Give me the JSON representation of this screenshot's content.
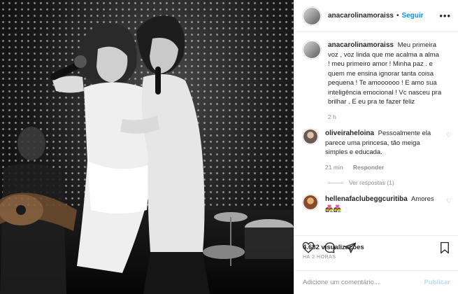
{
  "post": {
    "author": "anacarolinamoraiss",
    "follow_label": "Seguir",
    "separator": "•",
    "more_icon": "more-dots-icon",
    "caption": "Meu primeira voz , voz linda que me acalma a alma ! meu primeiro amor ! Minha paz . e quem me ensina ignorar tanta coisa pequena ! Te amoooooo ! E amo sua inteligência emocional ! Vc nasceu pra brilhar . E eu pra te fazer feliz",
    "caption_time": "2 h",
    "views": "4.682 visualizações",
    "posted": "HÁ 2 HORAS"
  },
  "comments": [
    {
      "user": "oliveiraheloina",
      "text": "Pessoalmente ela parece uma princesa, tão meiga simples e educada.",
      "time": "21 min",
      "reply_label": "Responder",
      "view_replies": "Ver respostas (1)"
    },
    {
      "user": "hellenafaclubeggcuritiba",
      "text": "Amores 👩‍❤️‍👨👩‍❤️‍👨"
    }
  ],
  "actions": {
    "icons": [
      "heart-icon",
      "comment-icon",
      "share-icon",
      "bookmark-icon"
    ]
  },
  "add_comment": {
    "placeholder": "Adicione um comentário...",
    "publish_label": "Publicar"
  },
  "colors": {
    "link_blue": "#0095f6",
    "muted_gray": "#8e8e8e",
    "text_dark": "#262626",
    "publish_disabled": "#b2dffc"
  }
}
